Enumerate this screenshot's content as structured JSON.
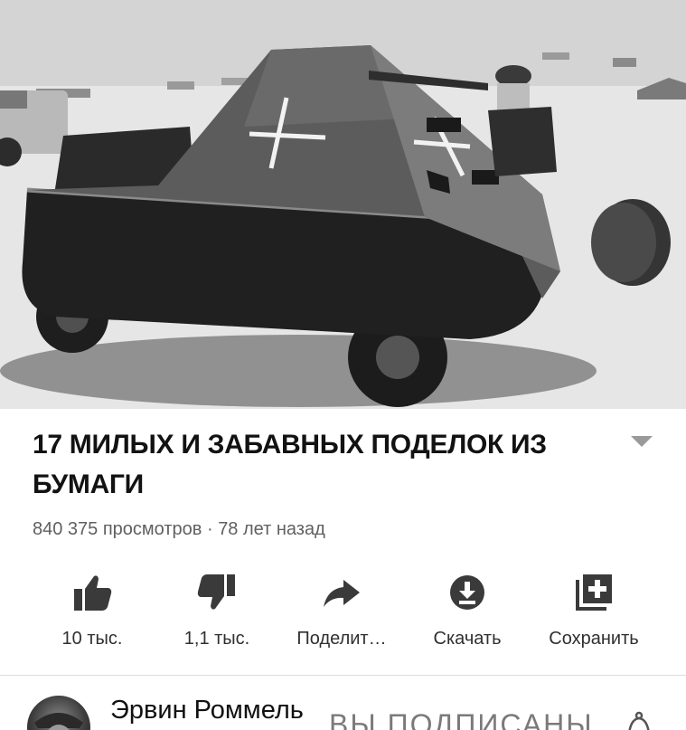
{
  "video": {
    "title": "17 МИЛЫХ И ЗАБАВНЫХ ПОДЕЛОК ИЗ БУМАГИ",
    "views": "840 375 просмотров",
    "separator": " · ",
    "age": "78 лет назад",
    "thumbnail_icon": "paper-tank-photo"
  },
  "actions": {
    "like": {
      "label": "10 тыс.",
      "icon": "thumbs-up-icon"
    },
    "dislike": {
      "label": "1,1 тыс.",
      "icon": "thumbs-down-icon"
    },
    "share": {
      "label": "Поделит…",
      "icon": "share-arrow-icon"
    },
    "download": {
      "label": "Скачать",
      "icon": "download-icon"
    },
    "save": {
      "label": "Сохранить",
      "icon": "add-to-playlist-icon"
    }
  },
  "channel": {
    "name": "Эрвин Роммель",
    "subscribed_label": "ВЫ ПОДПИСАНЫ",
    "bell_icon": "bell-icon"
  },
  "colors": {
    "title": "#121212",
    "meta": "#606060",
    "icon": "#3a3a3a",
    "subscribed": "#7a7a7a"
  }
}
